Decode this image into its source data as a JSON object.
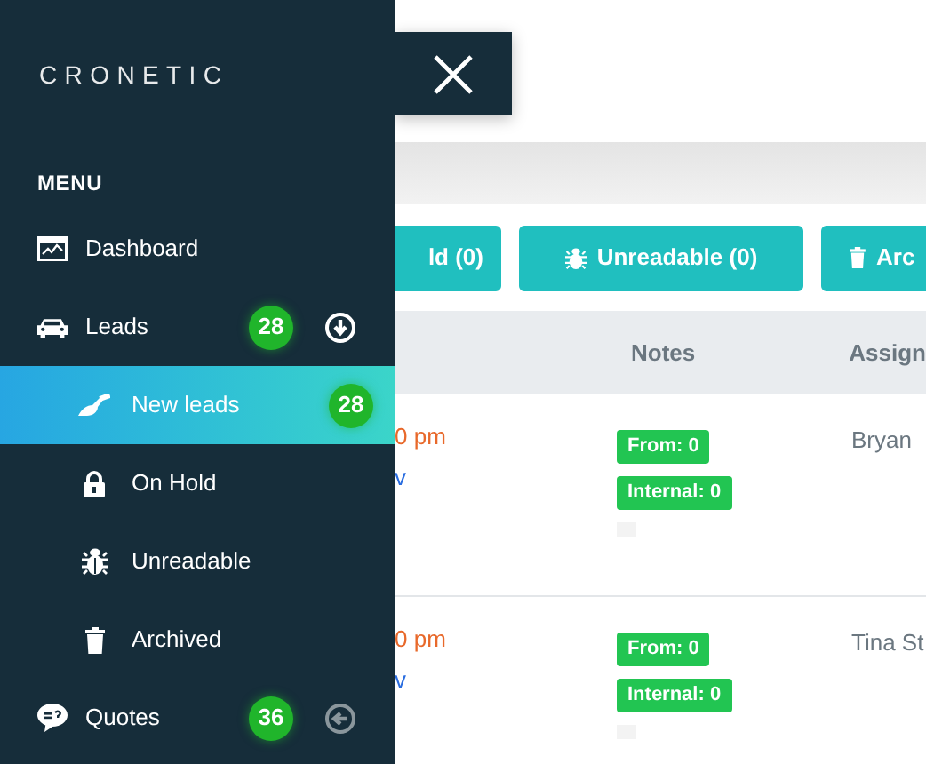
{
  "sidebar": {
    "logo": "CRONETIC",
    "heading": "MENU",
    "items": [
      {
        "label": "Dashboard"
      },
      {
        "label": "Leads",
        "badge": "28",
        "expanded": true,
        "children": [
          {
            "label": "New leads",
            "badge": "28",
            "selected": true
          },
          {
            "label": "On Hold",
            "selected": false
          },
          {
            "label": "Unreadable",
            "selected": false
          },
          {
            "label": "Archived",
            "selected": false
          }
        ]
      },
      {
        "label": "Quotes",
        "badge": "36",
        "expanded": false
      }
    ]
  },
  "filter_buttons": [
    "ld (0)",
    "Unreadable (0)",
    "Arc"
  ],
  "table": {
    "columns": [
      "Notes",
      "Assign"
    ],
    "rows": [
      {
        "time": "0 pm",
        "link": "v",
        "notes": [
          "From: 0",
          "Internal: 0"
        ],
        "assignee": "Bryan"
      },
      {
        "time": "0 pm",
        "link": "v",
        "notes": [
          "From: 0",
          "Internal: 0"
        ],
        "assignee": "Tina St"
      }
    ]
  }
}
